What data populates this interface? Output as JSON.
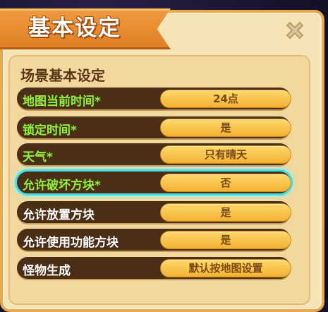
{
  "dialog": {
    "title": "基本设定",
    "section_title": "场景基本设定",
    "close_icon": "close-x-icon"
  },
  "settings": [
    {
      "label": "地图当前时间*",
      "value": "24点",
      "label_color": "#8ef33a",
      "highlighted": false
    },
    {
      "label": "锁定时间*",
      "value": "是",
      "label_color": "#8ef33a",
      "highlighted": false
    },
    {
      "label": "天气*",
      "value": "只有晴天",
      "label_color": "#8ef33a",
      "highlighted": false
    },
    {
      "label": "允许破坏方块*",
      "value": "否",
      "label_color": "#8ef33a",
      "highlighted": true
    },
    {
      "label": "允许放置方块",
      "value": "是",
      "label_color": "#ffffff",
      "highlighted": false
    },
    {
      "label": "允许使用功能方块",
      "value": "是",
      "label_color": "#ffffff",
      "highlighted": false
    },
    {
      "label": "怪物生成",
      "value": "默认按地图设置",
      "label_color": "#ffffff",
      "highlighted": false
    }
  ],
  "colors": {
    "accent_orange": "#e07f26",
    "highlight_cyan": "#3be0e8",
    "label_green": "#8ef33a"
  }
}
